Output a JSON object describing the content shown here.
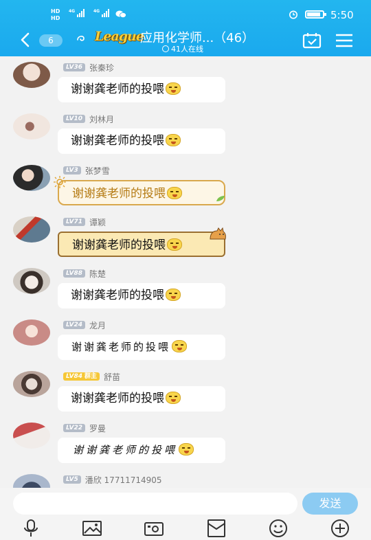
{
  "status_bar": {
    "network_top": "HD",
    "network_bottom": "HD",
    "sim1_gen": "4G",
    "sim2_gen": "4G",
    "time": "5:50"
  },
  "header": {
    "unread_count": "6",
    "league_badge": "League",
    "group_title": "应用化学师...（46）",
    "online_text": "41人在线"
  },
  "messages": [
    {
      "level": "LV36",
      "name": "张秦珍",
      "text": "谢谢龚老师的投喂",
      "style": "plain",
      "avatar_color": "#caa58e"
    },
    {
      "level": "LV10",
      "name": "刘林月",
      "text": "谢谢龚老师的投喂",
      "style": "plain",
      "avatar_color": "#e9d3c7"
    },
    {
      "level": "LV3",
      "name": "张梦雪",
      "text": "谢谢龚老师的投喂",
      "style": "gold",
      "avatar_color": "#6d7a8a"
    },
    {
      "level": "LV71",
      "name": "谭颖",
      "text": "谢谢龚老师的投喂",
      "style": "scroll",
      "avatar_color": "#7c93a3"
    },
    {
      "level": "LV88",
      "name": "陈楚",
      "text": "谢谢龚老师的投喂",
      "style": "plain",
      "avatar_color": "#b5b0a8"
    },
    {
      "level": "LV24",
      "name": "龙月",
      "text": "谢谢龚老师的投喂",
      "style": "hand",
      "avatar_color": "#d9a9a6"
    },
    {
      "level": "LV84",
      "owner_tag": "群主",
      "name": "舒苗",
      "text": "谢谢龚老师的投喂",
      "style": "plain",
      "avatar_color": "#a28c84"
    },
    {
      "level": "LV22",
      "name": "罗曼",
      "text": "谢谢龚老师的投喂",
      "style": "brush",
      "avatar_color": "#d07a7a"
    },
    {
      "level": "LV5",
      "name": "潘欣 17711714905",
      "text": "",
      "style": "plain",
      "avatar_color": "#5b6f8c"
    }
  ],
  "input_bar": {
    "placeholder": "",
    "send_label": "发送"
  },
  "colors": {
    "header_blue": "#1fb0ef",
    "send_button": "#8ccbf2",
    "level_badge": "#b4bcc8",
    "owner_badge": "#f6c736"
  },
  "toolbar_icons": [
    "microphone-icon",
    "image-icon",
    "camera-icon",
    "red-packet-icon",
    "emoji-icon",
    "plus-icon"
  ]
}
